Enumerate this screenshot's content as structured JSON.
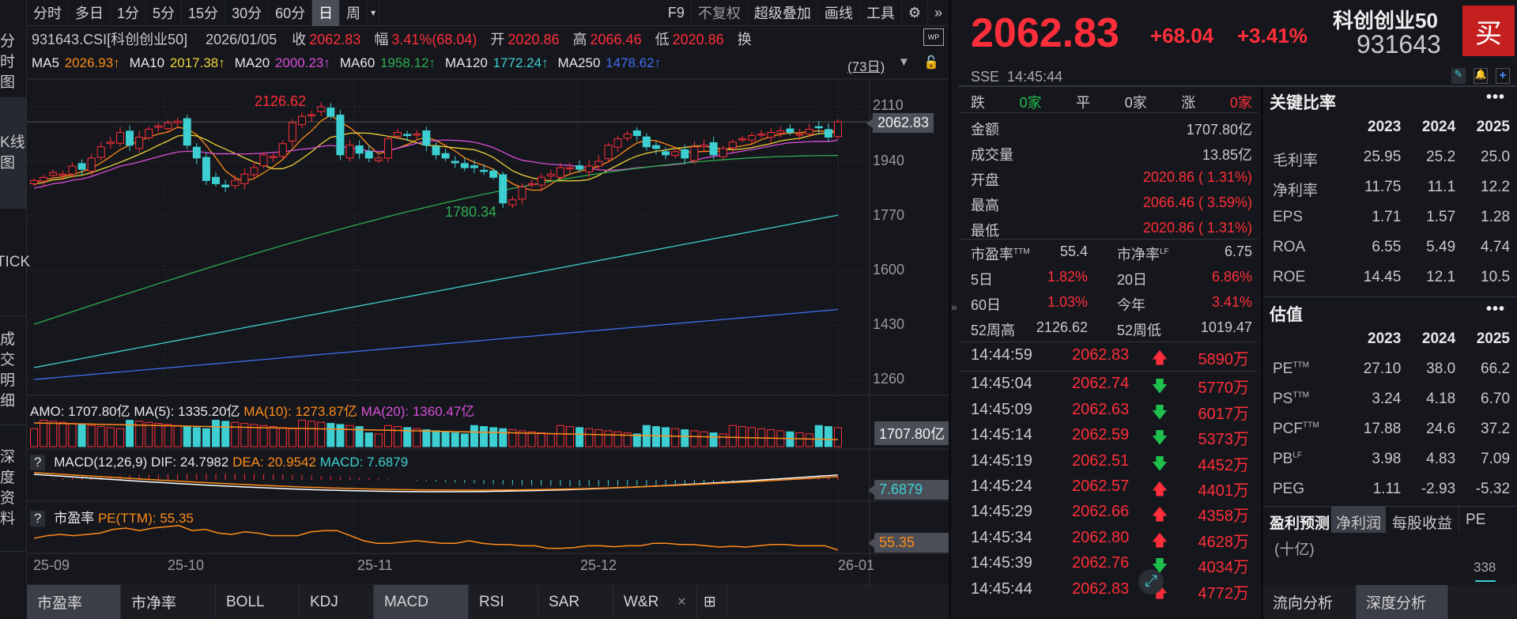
{
  "left_tabs": [
    "分时图",
    "K线图",
    "TICK",
    "成交明细",
    "深度资料"
  ],
  "toolbar": {
    "periods": [
      "分时",
      "多日",
      "1分",
      "5分",
      "15分",
      "30分",
      "60分",
      "日",
      "周"
    ],
    "selected": "日",
    "actions": [
      "F9",
      "不复权",
      "超级叠加",
      "画线",
      "工具"
    ]
  },
  "info": {
    "code": "931643.CSI[科创创业50]",
    "date": "2026/01/05",
    "close_lbl": "收",
    "close": "2062.83",
    "chg_lbl": "幅",
    "chg": "3.41%(68.04)",
    "open_lbl": "开",
    "open": "2020.86",
    "high_lbl": "高",
    "high": "2066.46",
    "low_lbl": "低",
    "low": "2020.86",
    "turn_lbl": "换"
  },
  "ma": [
    {
      "name": "MA5",
      "value": "2026.93↑",
      "color": "#ff8c1a"
    },
    {
      "name": "MA10",
      "value": "2017.38↑",
      "color": "#f0d43a"
    },
    {
      "name": "MA20",
      "value": "2000.23↑",
      "color": "#d94fd9"
    },
    {
      "name": "MA60",
      "value": "1958.12↑",
      "color": "#2fae4f"
    },
    {
      "name": "MA120",
      "value": "1772.24↑",
      "color": "#3ecfd2"
    },
    {
      "name": "MA250",
      "value": "1478.62↑",
      "color": "#3f6ff0"
    }
  ],
  "range_label": "(73日)",
  "chart_data": {
    "type": "candlestick",
    "yticks": [
      2110,
      1940,
      1770,
      1600,
      1430,
      1260
    ],
    "ylim": [
      1230,
      2160
    ],
    "xticks": [
      "25-09",
      "25-10",
      "25-11",
      "25-12",
      "26-01"
    ],
    "current_price": "2062.83",
    "max_label": "2126.62",
    "min_label": "1780.34",
    "closes": [
      1880,
      1890,
      1905,
      1900,
      1925,
      1915,
      1950,
      1985,
      2000,
      2030,
      1990,
      2015,
      2040,
      2050,
      2060,
      2065,
      1990,
      1950,
      1880,
      1870,
      1860,
      1880,
      1900,
      1920,
      1960,
      1955,
      1995,
      2060,
      2080,
      2085,
      2110,
      2080,
      1960,
      1990,
      1965,
      1950,
      1950,
      2010,
      2030,
      2020,
      2025,
      1990,
      1960,
      1950,
      1935,
      1920,
      1920,
      1910,
      1890,
      1810,
      1820,
      1860,
      1870,
      1890,
      1900,
      1920,
      1920,
      1915,
      1925,
      1940,
      1990,
      2010,
      2025,
      2020,
      1985,
      1980,
      1960,
      1970,
      1950,
      1985,
      1990,
      1960,
      1980,
      2000,
      2010,
      2020,
      2025,
      2030,
      2035,
      2030,
      2025,
      2040,
      2045,
      2015,
      2062.83
    ],
    "ma60": [
      1432,
      1958
    ],
    "ma120": [
      1297,
      1772
    ],
    "ma250": [
      1260,
      1478
    ],
    "volume": {
      "title": "AMO: 1707.80亿",
      "ma5": "MA(5): 1335.20亿",
      "ma10": "MA(10): 1273.87亿",
      "ma20": "MA(20): 1360.47亿",
      "last": "1707.80亿"
    },
    "macd": {
      "title": "MACD(12,26,9)",
      "dif": "DIF: 24.7982",
      "dea": "DEA: 20.9542",
      "macd": "MACD: 7.6879",
      "last": "7.6879"
    },
    "pe": {
      "title": "市盈率",
      "label": "PE(TTM): 55.35",
      "last": "55.35",
      "values": [
        60,
        61,
        61.5,
        61,
        61.5,
        62,
        63.5,
        64,
        63,
        64,
        64.5,
        65,
        63,
        63.5,
        62,
        61.5,
        62.5,
        62,
        61,
        61,
        61,
        62.5,
        63,
        63,
        61,
        59,
        58,
        58,
        58.5,
        59,
        58.5,
        58,
        58,
        59,
        58,
        57.5,
        57.5,
        57,
        57,
        56,
        56,
        56.3,
        57,
        57,
        56.6,
        57,
        57,
        58,
        58,
        57.5,
        57.5,
        57,
        56.5,
        56.8,
        56.5,
        57,
        57.5,
        57.5,
        57,
        57,
        57,
        55.35
      ]
    }
  },
  "bottom_tabs": [
    "市盈率",
    "市净率",
    "BOLL",
    "KDJ",
    "MACD",
    "RSI",
    "SAR",
    "W&R"
  ],
  "quote": {
    "price": "2062.83",
    "change": "+68.04",
    "pct": "+3.41%",
    "name": "科创创业50",
    "code": "931643",
    "buy": "买",
    "exchange": "SSE",
    "time": "14:45:44",
    "breadth": {
      "down_lbl": "跌",
      "down": "0家",
      "flat_lbl": "平",
      "flat": "0家",
      "up_lbl": "涨",
      "up": "0家"
    },
    "rows": [
      {
        "k": "金额",
        "v": "1707.80亿",
        "red": false
      },
      {
        "k": "成交量",
        "v": "13.85亿",
        "red": false
      },
      {
        "k": "开盘",
        "v": "2020.86 ( 1.31%)",
        "red": true
      },
      {
        "k": "最高",
        "v": "2066.46 ( 3.59%)",
        "red": true
      },
      {
        "k": "最低",
        "v": "2020.86 ( 1.31%)",
        "red": true
      }
    ],
    "stats": [
      [
        "市盈率",
        "TTM",
        "55.4",
        "市净率",
        "LF",
        "6.75"
      ],
      [
        "5日",
        "",
        "1.82%",
        "20日",
        "",
        "6.86%"
      ],
      [
        "60日",
        "",
        "1.03%",
        "今年",
        "",
        "3.41%"
      ],
      [
        "52周高",
        "",
        "2126.62",
        "52周低",
        "",
        "1019.47"
      ]
    ]
  },
  "ticks": [
    [
      "14:44:59",
      "2062.83",
      "up",
      "5890万"
    ],
    [
      "14:45:04",
      "2062.74",
      "down",
      "5770万"
    ],
    [
      "14:45:09",
      "2062.63",
      "down",
      "6017万"
    ],
    [
      "14:45:14",
      "2062.59",
      "down",
      "5373万"
    ],
    [
      "14:45:19",
      "2062.51",
      "down",
      "4452万"
    ],
    [
      "14:45:24",
      "2062.57",
      "up",
      "4401万"
    ],
    [
      "14:45:29",
      "2062.66",
      "up",
      "4358万"
    ],
    [
      "14:45:34",
      "2062.80",
      "up",
      "4628万"
    ],
    [
      "14:45:39",
      "2062.76",
      "down",
      "4034万"
    ],
    [
      "14:45:44",
      "2062.83",
      "up",
      "4772万"
    ]
  ],
  "ratios": {
    "title": "关键比率",
    "years": [
      "2023",
      "2024",
      "2025"
    ],
    "rows": [
      [
        "毛利率",
        "",
        "25.95",
        "25.2",
        "25.0"
      ],
      [
        "净利率",
        "",
        "11.75",
        "11.1",
        "12.2"
      ],
      [
        "EPS",
        "",
        "1.71",
        "1.57",
        "1.28"
      ],
      [
        "ROA",
        "",
        "6.55",
        "5.49",
        "4.74"
      ],
      [
        "ROE",
        "",
        "14.45",
        "12.1",
        "10.5"
      ]
    ]
  },
  "valuation": {
    "title": "估值",
    "years": [
      "2023",
      "2024",
      "2025"
    ],
    "rows": [
      [
        "PE",
        "TTM",
        "27.10",
        "38.0",
        "66.2"
      ],
      [
        "PS",
        "TTM",
        "3.24",
        "4.18",
        "6.70"
      ],
      [
        "PCF",
        "TTM",
        "17.88",
        "24.6",
        "37.2"
      ],
      [
        "PB",
        "LF",
        "3.98",
        "4.83",
        "7.09"
      ],
      [
        "PEG",
        "",
        "1.11",
        "-2.93",
        "-5.32"
      ]
    ]
  },
  "forecast": {
    "tabs": [
      "盈利预测",
      "净利润",
      "每股收益",
      "PE"
    ],
    "unit": "(十亿)",
    "value": "338"
  },
  "bottom_right_tabs": [
    "流向分析",
    "深度分析"
  ]
}
